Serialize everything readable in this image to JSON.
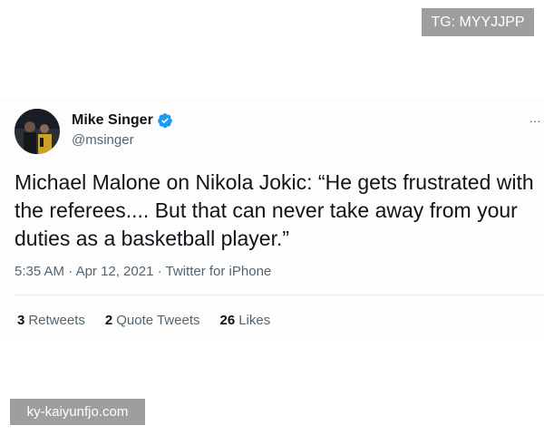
{
  "watermark_top": "TG: MYYJJPP",
  "watermark_bottom": "ky-kaiyunfjo.com",
  "tweet": {
    "display_name": "Mike Singer",
    "handle": "@msinger",
    "text": "Michael Malone on Nikola Jokic: “He gets frustrated with the referees.... But that can never take away from your duties as a basketball player.”",
    "time": "5:35 AM",
    "date": "Apr 12, 2021",
    "source": "Twitter for iPhone",
    "more_icon": "…"
  },
  "stats": {
    "retweets_count": "3",
    "retweets_label": "Retweets",
    "quote_count": "2",
    "quote_label": "Quote Tweets",
    "likes_count": "26",
    "likes_label": "Likes"
  },
  "colors": {
    "verified": "#1d9bf0",
    "secondary_text": "#536471",
    "primary_text": "#0f1419"
  }
}
